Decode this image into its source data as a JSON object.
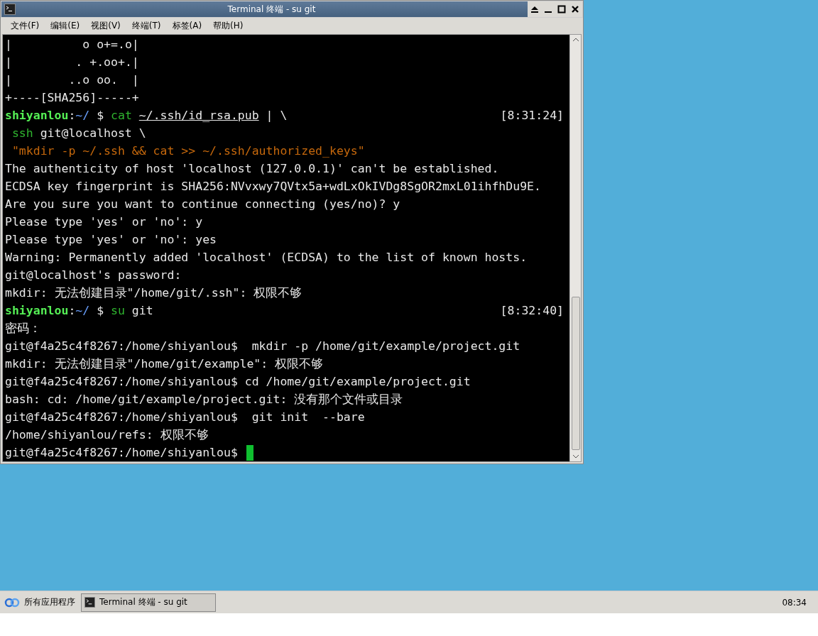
{
  "window": {
    "title": "Terminal 终端 - su git"
  },
  "menu": [
    "文件(F)",
    "编辑(E)",
    "视图(V)",
    "终端(T)",
    "标签(A)",
    "帮助(H)"
  ],
  "terminal": {
    "lines": [
      {
        "segments": [
          {
            "kind": "plain",
            "text": "|          o o+=.o|"
          }
        ]
      },
      {
        "segments": [
          {
            "kind": "plain",
            "text": "|         . +.oo+.|"
          }
        ]
      },
      {
        "segments": [
          {
            "kind": "plain",
            "text": "|        ..o oo.  |"
          }
        ]
      },
      {
        "segments": [
          {
            "kind": "plain",
            "text": "+----[SHA256]-----+"
          }
        ]
      },
      {
        "segments": [
          {
            "kind": "user",
            "text": "shiyanlou"
          },
          {
            "kind": "plain",
            "text": ":"
          },
          {
            "kind": "path",
            "text": "~/"
          },
          {
            "kind": "plain",
            "text": " $ "
          },
          {
            "kind": "command",
            "text": "cat"
          },
          {
            "kind": "underline",
            "text": "~/.ssh/id_rsa.pub",
            "gap": true
          },
          {
            "kind": "plain",
            "text": " | \\"
          }
        ],
        "time": "[8:31:24]"
      },
      {
        "segments": [
          {
            "kind": "command",
            "text": "ssh",
            "gap": true
          },
          {
            "kind": "plain",
            "text": " git@localhost \\"
          }
        ]
      },
      {
        "segments": [
          {
            "kind": "string",
            "gap": true,
            "text": "\"mkdir -p ~/.ssh && cat >> ~/.ssh/authorized_keys\""
          }
        ]
      },
      {
        "segments": [
          {
            "kind": "plain",
            "text": "The authenticity of host 'localhost (127.0.0.1)' can't be established."
          }
        ]
      },
      {
        "segments": [
          {
            "kind": "plain",
            "text": "ECDSA key fingerprint is SHA256:NVvxwy7QVtx5a+wdLxOkIVDg8SgOR2mxL01ihfhDu9E."
          }
        ]
      },
      {
        "segments": [
          {
            "kind": "plain",
            "text": "Are you sure you want to continue connecting (yes/no)? y"
          }
        ]
      },
      {
        "segments": [
          {
            "kind": "plain",
            "text": "Please type 'yes' or 'no': y"
          }
        ]
      },
      {
        "segments": [
          {
            "kind": "plain",
            "text": "Please type 'yes' or 'no': yes"
          }
        ]
      },
      {
        "segments": [
          {
            "kind": "plain",
            "text": "Warning: Permanently added 'localhost' (ECDSA) to the list of known hosts."
          }
        ]
      },
      {
        "segments": [
          {
            "kind": "plain",
            "text": "git@localhost's password:"
          }
        ]
      },
      {
        "segments": [
          {
            "kind": "plain",
            "text": "mkdir: 无法创建目录\"/home/git/.ssh\": 权限不够"
          }
        ]
      },
      {
        "segments": [
          {
            "kind": "user",
            "text": "shiyanlou"
          },
          {
            "kind": "plain",
            "text": ":"
          },
          {
            "kind": "path",
            "text": "~/"
          },
          {
            "kind": "plain",
            "text": " $ "
          },
          {
            "kind": "command",
            "text": "su"
          },
          {
            "kind": "plain",
            "text": " git"
          }
        ],
        "time": "[8:32:40]"
      },
      {
        "segments": [
          {
            "kind": "plain",
            "text": "密码："
          }
        ]
      },
      {
        "segments": [
          {
            "kind": "plain",
            "text": "git@f4a25c4f8267:/home/shiyanlou$  mkdir -p /home/git/example/project.git"
          }
        ]
      },
      {
        "segments": [
          {
            "kind": "plain",
            "text": "mkdir: 无法创建目录\"/home/git/example\": 权限不够"
          }
        ]
      },
      {
        "segments": [
          {
            "kind": "plain",
            "text": "git@f4a25c4f8267:/home/shiyanlou$ cd /home/git/example/project.git"
          }
        ]
      },
      {
        "segments": [
          {
            "kind": "plain",
            "text": "bash: cd: /home/git/example/project.git: 没有那个文件或目录"
          }
        ]
      },
      {
        "segments": [
          {
            "kind": "plain",
            "text": "git@f4a25c4f8267:/home/shiyanlou$  git init  --bare"
          }
        ]
      },
      {
        "segments": [
          {
            "kind": "plain",
            "text": "/home/shiyanlou/refs: 权限不够"
          }
        ]
      },
      {
        "segments": [
          {
            "kind": "plain",
            "text": "git@f4a25c4f8267:/home/shiyanlou$ "
          }
        ],
        "cursor": true
      }
    ]
  },
  "taskbar": {
    "start": "所有应用程序",
    "tasks": [
      {
        "label": "Terminal 终端 - su git",
        "selected": true
      }
    ],
    "clock": "08:34"
  }
}
